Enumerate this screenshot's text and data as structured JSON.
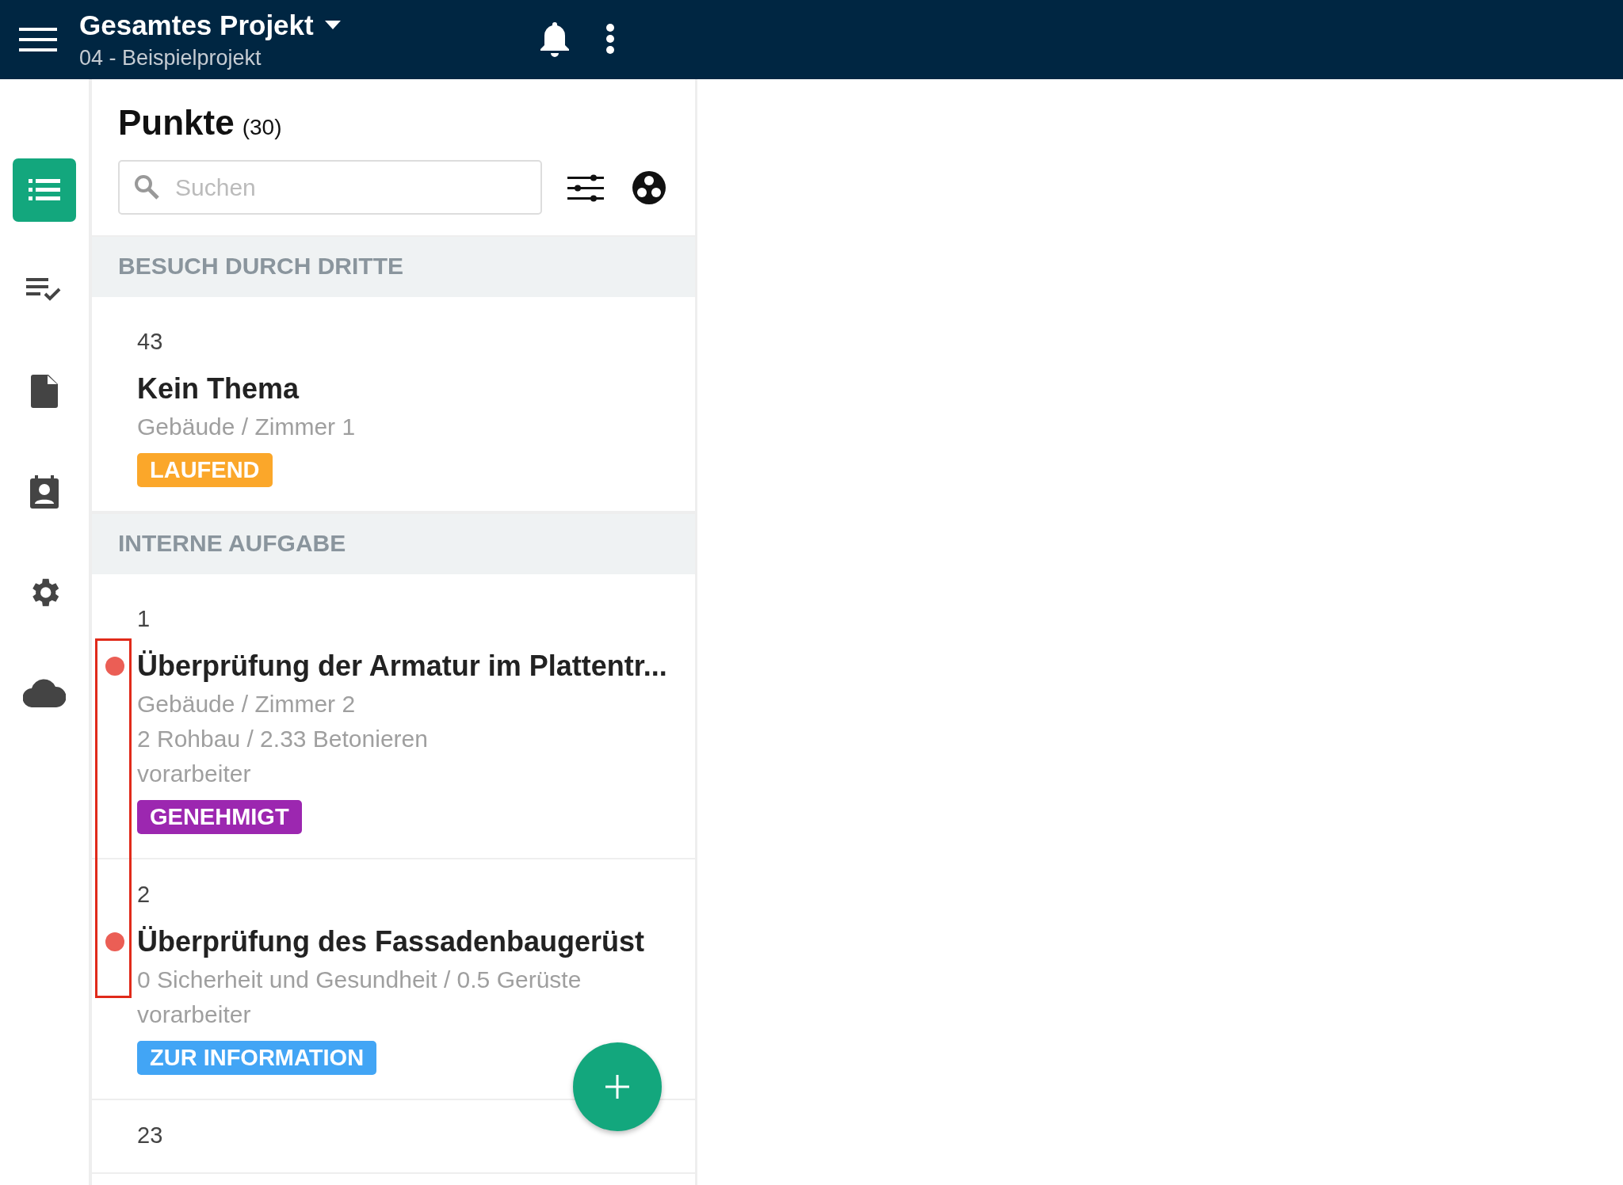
{
  "header": {
    "title": "Gesamtes Projekt",
    "subtitle": "04 - Beispielprojekt"
  },
  "sidebar": {
    "items": [
      {
        "kind": "list",
        "selected": true
      },
      {
        "kind": "checklist",
        "selected": false
      },
      {
        "kind": "document",
        "selected": false
      },
      {
        "kind": "contact",
        "selected": false
      },
      {
        "kind": "settings",
        "selected": false
      },
      {
        "kind": "cloud",
        "selected": false
      }
    ]
  },
  "panel": {
    "title": "Punkte",
    "count": "(30)",
    "search": {
      "placeholder": "Suchen"
    },
    "groups": [
      {
        "heading": "BESUCH DURCH DRITTE",
        "items": [
          {
            "number": "43",
            "title": "Kein Thema",
            "flagged": false,
            "lines": [
              "Gebäude / Zimmer 1"
            ],
            "status": {
              "label": "LAUFEND",
              "color": "#fba72a"
            }
          }
        ]
      },
      {
        "heading": "INTERNE AUFGABE",
        "items": [
          {
            "number": "1",
            "title": "Überprüfung der Armatur im Plattentr...",
            "flagged": true,
            "lines": [
              "Gebäude / Zimmer 2",
              "2 Rohbau / 2.33 Betonieren",
              "vorarbeiter"
            ],
            "status": {
              "label": "GENEHMIGT",
              "color": "#9c27b0"
            }
          },
          {
            "number": "2",
            "title": "Überprüfung des Fassadenbaugerüst",
            "flagged": true,
            "lines": [
              "0 Sicherheit und Gesundheit / 0.5 Gerüste",
              "vorarbeiter"
            ],
            "status": {
              "label": "ZUR INFORMATION",
              "color": "#42a5f5"
            }
          },
          {
            "number": "23"
          }
        ]
      }
    ]
  }
}
